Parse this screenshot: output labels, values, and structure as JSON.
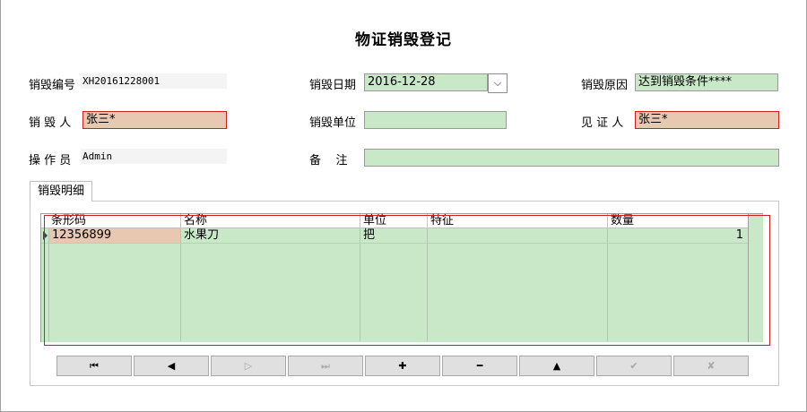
{
  "title": "物证销毁登记",
  "form": {
    "code_label": "销毁编号",
    "code_value": "XH20161228001",
    "date_label": "销毁日期",
    "date_value": "2016-12-28",
    "date_dropdown_glyph": "⌵",
    "reason_label": "销毁原因",
    "reason_value": "达到销毁条件****",
    "destroyer_label": "销 毁 人",
    "destroyer_value": "张三*",
    "unit_label": "销毁单位",
    "unit_value": "",
    "witness_label": "见 证 人",
    "witness_value": "张三*",
    "operator_label": "操 作 员",
    "operator_value": "Admin",
    "remark_label": "备    注",
    "remark_value": ""
  },
  "tab": {
    "label": "销毁明细"
  },
  "grid": {
    "columns": [
      "条形码",
      "名称",
      "单位",
      "特征",
      "数量"
    ],
    "rows": [
      {
        "barcode": "12356899",
        "name": "水果刀",
        "unit": "把",
        "feature": "",
        "qty": "1"
      }
    ]
  },
  "navigator": {
    "buttons": [
      {
        "glyph": "⏮",
        "icon": "first-record-icon",
        "enabled": true
      },
      {
        "glyph": "◀",
        "icon": "prior-record-icon",
        "enabled": true
      },
      {
        "glyph": "▷",
        "icon": "next-record-icon",
        "enabled": false
      },
      {
        "glyph": "⏭",
        "icon": "last-record-icon",
        "enabled": false
      },
      {
        "glyph": "✚",
        "icon": "insert-record-icon",
        "enabled": true
      },
      {
        "glyph": "━",
        "icon": "delete-record-icon",
        "enabled": true
      },
      {
        "glyph": "▲",
        "icon": "edit-record-icon",
        "enabled": true
      },
      {
        "glyph": "✔",
        "icon": "post-record-icon",
        "enabled": false
      },
      {
        "glyph": "✘",
        "icon": "cancel-record-icon",
        "enabled": false
      }
    ]
  },
  "colors": {
    "editable_field": "#c8e8c8",
    "required_field": "#e8c8b0",
    "required_border": "#cc2020"
  }
}
